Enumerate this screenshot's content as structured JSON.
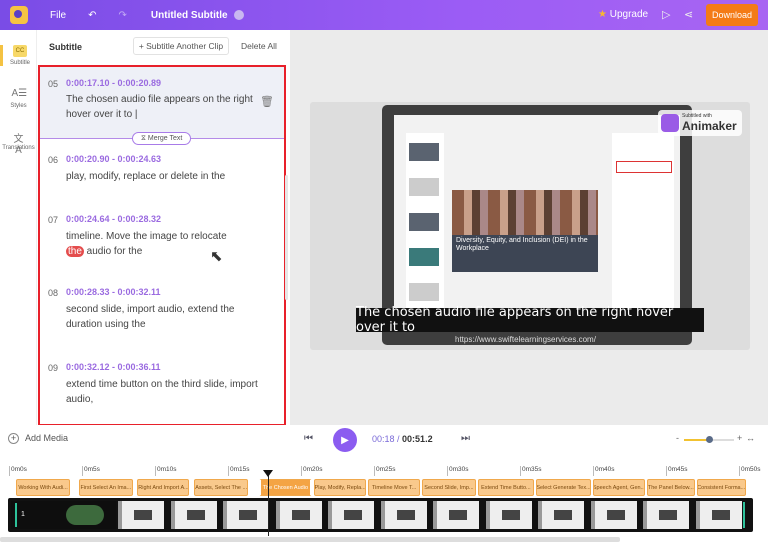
{
  "topbar": {
    "file": "File",
    "title": "Untitled Subtitle",
    "upgrade": "Upgrade",
    "download": "Download",
    "accent": "#7a4ce6",
    "download_color": "#f47b16"
  },
  "rail": [
    {
      "label": "Subtitle",
      "icon": "cc-icon",
      "glyph": "CC"
    },
    {
      "label": "Styles",
      "icon": "text-style-icon",
      "glyph": "A☰"
    },
    {
      "label": "Translations",
      "icon": "translate-icon",
      "glyph": "文A"
    }
  ],
  "panel": {
    "title": "Subtitle",
    "add_clip": "+ Subtitle Another Clip",
    "delete_all": "Delete All",
    "merge": "⧖ Merge Text"
  },
  "subtitles": [
    {
      "index": "05",
      "time": "0:00:17.10  -  0:00:20.89",
      "text": "The chosen audio file appears on the right hover over it to |"
    },
    {
      "index": "06",
      "time": "0:00:20.90  -  0:00:24.63",
      "text": "play, modify, replace or delete in the"
    },
    {
      "index": "07",
      "time": "0:00:24.64  -  0:00:28.32",
      "text_pre": "timeline. Move the image to relocate",
      "highlight": "the",
      "text_post": " audio for the"
    },
    {
      "index": "08",
      "time": "0:00:28.33  -  0:00:32.11",
      "text": "second slide, import audio, extend the duration using the"
    },
    {
      "index": "09",
      "time": "0:00:32.12  -  0:00:36.11",
      "text": "extend time button on the third slide, import audio,"
    }
  ],
  "preview": {
    "caption": "The chosen audio file appears on the right hover over it to",
    "url": "https://www.swiftelearningservices.com/",
    "slide_title": "Diversity, Equity, and Inclusion (DEI) in the Workplace",
    "badge_small": "Subtitled with",
    "badge_big": "Animaker"
  },
  "controls": {
    "add_media": "Add Media",
    "current": "00:18",
    "separator": " / ",
    "total": "00:51.2",
    "zoom_level": 0.5
  },
  "ruler": [
    "0m0s",
    "0m5s",
    "0m10s",
    "0m15s",
    "0m20s",
    "0m25s",
    "0m30s",
    "0m35s",
    "0m40s",
    "0m45s",
    "0m50s"
  ],
  "clips": [
    {
      "label": "Working With Audi...",
      "start": 0.5,
      "end": 4.3
    },
    {
      "label": "First Select An Ima...",
      "start": 4.8,
      "end": 8.6
    },
    {
      "label": "Right And Import A...",
      "start": 8.8,
      "end": 12.5
    },
    {
      "label": "Assets, Select The ...",
      "start": 12.7,
      "end": 16.5
    },
    {
      "label": "The Chosen Audio",
      "start": 17.1,
      "end": 20.9,
      "active": true
    },
    {
      "label": "Play, Modify, Repla...",
      "start": 20.9,
      "end": 24.6
    },
    {
      "label": "Timeline Move T...",
      "start": 24.6,
      "end": 28.3
    },
    {
      "label": "Second Slide, Imp...",
      "start": 28.3,
      "end": 32.1
    },
    {
      "label": "Extend Time Butto...",
      "start": 32.1,
      "end": 36.1
    },
    {
      "label": "Select Generate Tex...",
      "start": 36.1,
      "end": 40.0
    },
    {
      "label": "Speech Agent, Gen...",
      "start": 40.0,
      "end": 43.7
    },
    {
      "label": "The Panel Below...",
      "start": 43.7,
      "end": 47.1
    },
    {
      "label": "Consistent Forma...",
      "start": 47.1,
      "end": 50.6
    }
  ],
  "track": {
    "first_label": "1"
  }
}
